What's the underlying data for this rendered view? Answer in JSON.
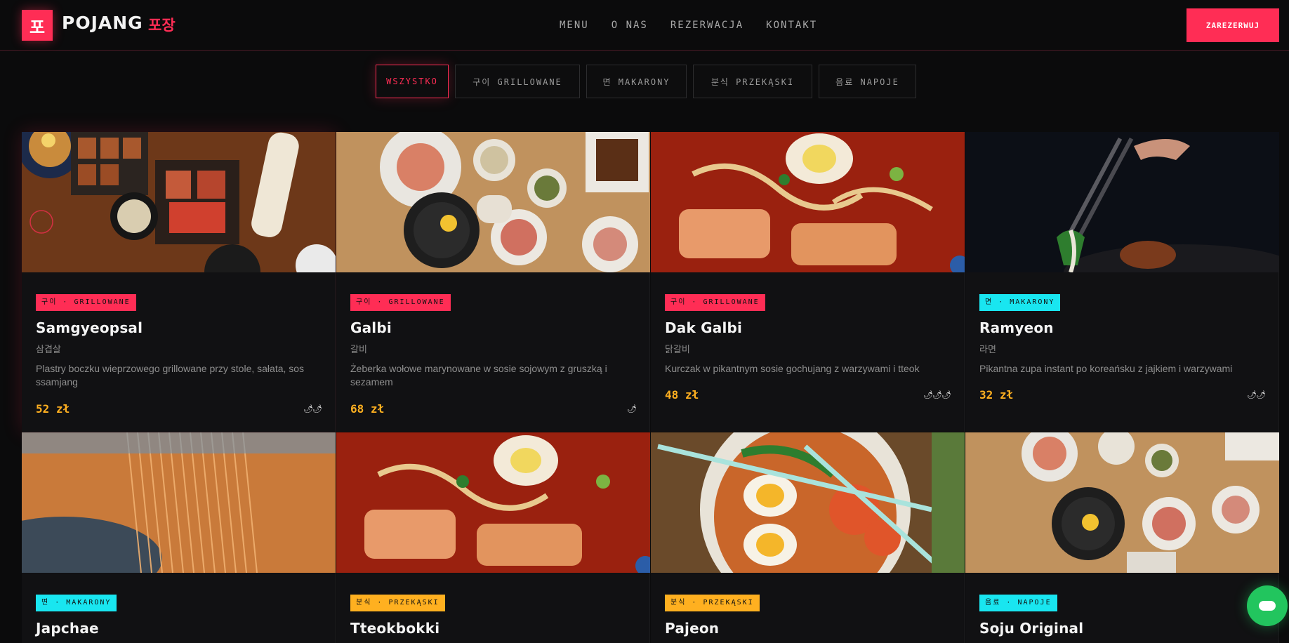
{
  "header": {
    "logo_glyph": "포",
    "brand": "POJANG",
    "brand_ko": "포장",
    "nav": [
      "MENU",
      "O NAS",
      "REZERWACJA",
      "KONTAKT"
    ],
    "reserve_label": "ZAREZERWUJ",
    "accent": "#ff2d55"
  },
  "filters": [
    {
      "label": "WSZYSTKO",
      "active": true
    },
    {
      "label": "구이 GRILLOWANE",
      "active": false
    },
    {
      "label": "면 MAKARONY",
      "active": false
    },
    {
      "label": "분식 PRZEKĄSKI",
      "active": false
    },
    {
      "label": "음료 NAPOJE",
      "active": false
    }
  ],
  "cards": [
    {
      "tag": "구이 · GRILLOWANE",
      "name": "Samgyeopsal",
      "ko": "삼겹살",
      "desc": "Plastry boczku wieprzowego grillowane przy stole, sałata, sos ssamjang",
      "price": "52 zł",
      "spice": "🌶🌶",
      "spice_level": 2
    },
    {
      "tag": "구이 · GRILLOWANE",
      "name": "Galbi",
      "ko": "갈비",
      "desc": "Żeberka wołowe marynowane w sosie sojowym z gruszką i sezamem",
      "price": "68 zł",
      "spice": "🌶",
      "spice_level": 1
    },
    {
      "tag": "구이 · GRILLOWANE",
      "name": "Dak Galbi",
      "ko": "닭갈비",
      "desc": "Kurczak w pikantnym sosie gochujang z warzywami i tteok",
      "price": "48 zł",
      "spice": "🌶🌶🌶",
      "spice_level": 3
    },
    {
      "tag": "면 · MAKARONY",
      "name": "Ramyeon",
      "ko": "라면",
      "desc": "Pikantna zupa instant po koreańsku z jajkiem i warzywami",
      "price": "32 zł",
      "spice": "🌶🌶",
      "spice_level": 2
    },
    {
      "tag": "면 · MAKARONY",
      "name": "Japchae"
    },
    {
      "tag": "분식 · PRZEKĄSKI",
      "name": "Tteokbokki"
    },
    {
      "tag": "분식 · PRZEKĄSKI",
      "name": "Pajeon"
    },
    {
      "tag": "음료 · NAPOJE",
      "name": "Soju Original"
    }
  ],
  "chat": {
    "icon": "chat-icon",
    "color": "#22c55e"
  }
}
